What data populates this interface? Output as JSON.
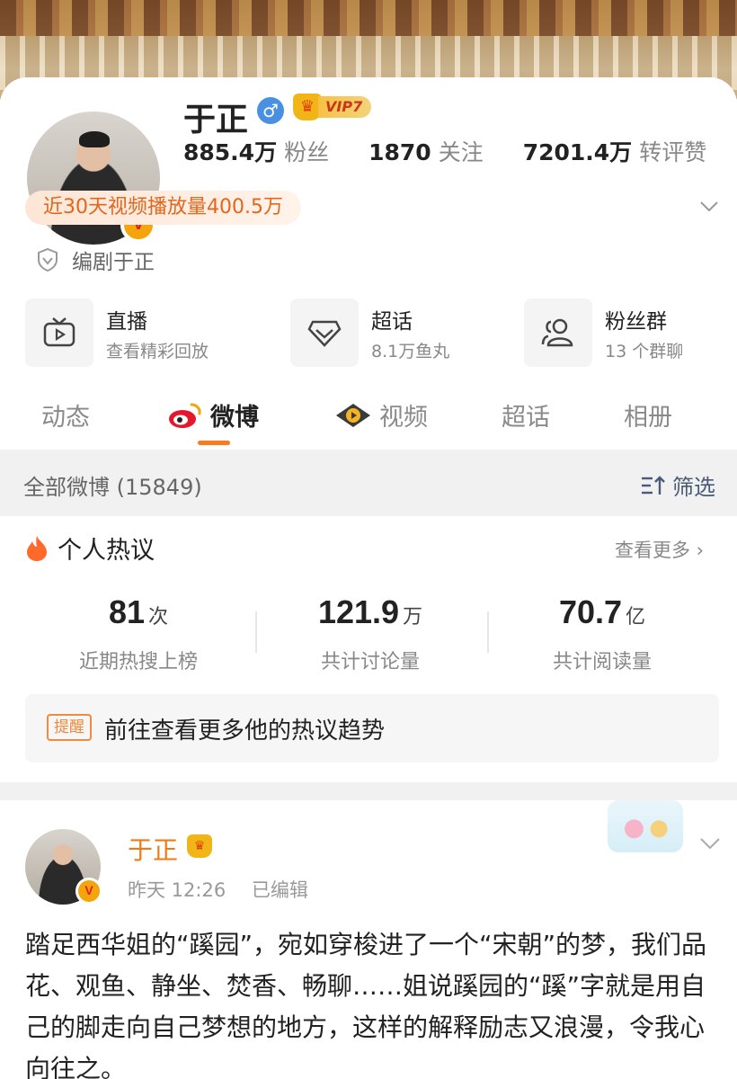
{
  "profile": {
    "name": "于正",
    "vip": "VIP7",
    "stats": [
      {
        "num": "885.4万",
        "label": "粉丝"
      },
      {
        "num": "1870",
        "label": "关注"
      },
      {
        "num": "7201.4万",
        "label": "转评赞"
      }
    ],
    "video_plays": "近30天视频播放量400.5万",
    "role": "编剧于正"
  },
  "services": [
    {
      "title": "直播",
      "sub": "查看精彩回放",
      "icon": "tv-icon"
    },
    {
      "title": "超话",
      "sub": "8.1万鱼丸",
      "icon": "diamond-icon"
    },
    {
      "title": "粉丝群",
      "sub": "13 个群聊",
      "icon": "group-icon"
    }
  ],
  "tabs": [
    "动态",
    "微博",
    "视频",
    "超话",
    "相册"
  ],
  "active_tab": "微博",
  "filter": {
    "all_label": "全部微博 (15849)",
    "filter_label": "筛选"
  },
  "hot": {
    "title": "个人热议",
    "more": "查看更多 ›",
    "metrics": [
      {
        "num": "81",
        "unit": "次",
        "caption": "近期热搜上榜"
      },
      {
        "num": "121.9",
        "unit": "万",
        "caption": "共计讨论量"
      },
      {
        "num": "70.7",
        "unit": "亿",
        "caption": "共计阅读量"
      }
    ],
    "remind_tag": "提醒",
    "remind_text": "前往查看更多他的热议趋势"
  },
  "post": {
    "author": "于正",
    "time": "昨天 12:26",
    "edited": "已编辑",
    "text": "踏足西华姐的“蹊园”，宛如穿梭进了一个“宋朝”的梦，我们品花、观鱼、静坐、焚香、畅聊……姐说蹊园的“蹊”字就是用自己的脚走向自己梦想的地方，这样的解释励志又浪漫，令我心向往之。"
  },
  "colors": {
    "accent": "#ff7a1c",
    "name_orange": "#f07a16",
    "link_blue": "#4a5b78"
  }
}
